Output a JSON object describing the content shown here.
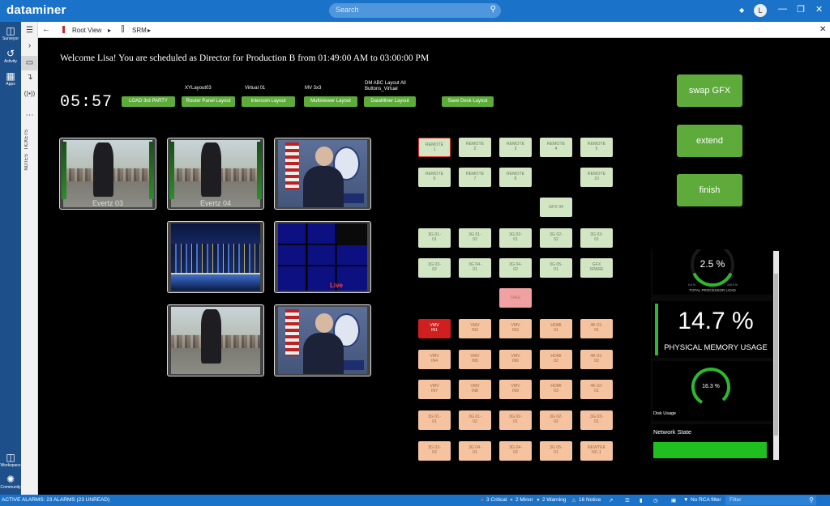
{
  "titlebar": {
    "brand": "dataminer",
    "search_placeholder": "Search",
    "avatar_initial": "L"
  },
  "rail": {
    "items": [
      {
        "label": "Surveyor",
        "icon": "surveyor-icon"
      },
      {
        "label": "Activity",
        "icon": "activity-icon"
      },
      {
        "label": "Apps",
        "icon": "apps-icon"
      }
    ],
    "bottom": [
      {
        "label": "Workspace",
        "icon": "workspace-icon"
      },
      {
        "label": "Community",
        "icon": "community-icon"
      }
    ]
  },
  "rail2": {
    "tickets": "TICKETS",
    "notes": "NOTES"
  },
  "breadcrumb": {
    "root": "Root View",
    "view": "SRM"
  },
  "main": {
    "welcome": "Welcome Lisa! You are scheduled as Director for Production B from 01:49:00 AM to 03:00:00 PM",
    "clock": "05:57",
    "layouts": [
      {
        "caption": "",
        "label": "LOAD 3rd PARTY"
      },
      {
        "caption": "XYLayout03",
        "label": "Router Panel Layout"
      },
      {
        "caption": "Virtual 01",
        "label": "Intercom Layout"
      },
      {
        "caption": "MV 3x3",
        "label": "Multiviewer Layout"
      },
      {
        "caption": "DM ABC Layout All Buttons_Virtual",
        "label": "DataMiner Layout"
      },
      {
        "caption": "",
        "label": "Save Desk Layout"
      }
    ],
    "actions": [
      "swap GFX",
      "extend",
      "finish"
    ],
    "tiles": [
      {
        "caption": "Evertz 03"
      },
      {
        "caption": "Evertz 04"
      },
      {
        "caption": ""
      },
      {
        "caption": ""
      },
      {
        "caption": "Live"
      },
      {
        "caption": ""
      },
      {
        "caption": ""
      }
    ]
  },
  "panel": {
    "remote": [
      [
        "REMOTE",
        "1"
      ],
      [
        "REMOTE",
        "2"
      ],
      [
        "REMOTE",
        "3"
      ],
      [
        "REMOTE",
        "4"
      ],
      [
        "REMOTE",
        "5"
      ],
      [
        "REMOTE",
        "6"
      ],
      [
        "REMOTE",
        "7"
      ],
      [
        "REMOTE",
        "8"
      ],
      [
        "REMOTE",
        "10"
      ]
    ],
    "gfx": [
      "GFX 04"
    ],
    "sources": [
      [
        "3G 01-",
        "01"
      ],
      [
        "3G 01-",
        "02"
      ],
      [
        "3G 02-",
        "01"
      ],
      [
        "3G 02-",
        "02"
      ],
      [
        "3G 03-",
        "01"
      ],
      [
        "3G 03-",
        "02"
      ],
      [
        "3G 04-",
        "01"
      ],
      [
        "3G 04-",
        "02"
      ],
      [
        "3G 05-",
        "01"
      ],
      [
        "GFX",
        "SPARE"
      ]
    ],
    "take": "TAKE",
    "destinations": [
      [
        "VMV",
        "IN1"
      ],
      [
        "VMV",
        "IN2"
      ],
      [
        "VMV",
        "IN3"
      ],
      [
        "HDMI",
        "01"
      ],
      [
        "4K 01-",
        "01"
      ],
      [
        "VMV",
        "IN4"
      ],
      [
        "VMV",
        "IN5"
      ],
      [
        "VMV",
        "IN6"
      ],
      [
        "HDMI",
        "02"
      ],
      [
        "4K 01-",
        "02"
      ],
      [
        "VMV",
        "IN7"
      ],
      [
        "VMV",
        "IN8"
      ],
      [
        "VMV",
        "IN9"
      ],
      [
        "HDMI",
        "03"
      ],
      [
        "4K 02-",
        "01"
      ],
      [
        "3G 01-",
        "01"
      ],
      [
        "3G 01-",
        "02"
      ],
      [
        "3G 02-",
        "01"
      ],
      [
        "3G 02-",
        "02"
      ],
      [
        "3G 03-",
        "01"
      ],
      [
        "3G 03-",
        "02"
      ],
      [
        "3G 04-",
        "01"
      ],
      [
        "3G 04-",
        "02"
      ],
      [
        "3G 05-",
        "01"
      ],
      [
        "NEWTEK",
        "NC-1"
      ]
    ],
    "selected_note": "REMOTE 1"
  },
  "stats": {
    "cpu": {
      "value": "2.5 %",
      "label": "TOTAL PROCESSOR LOAD",
      "min": "0.0 %",
      "max": "100.0 %",
      "fraction": 0.025
    },
    "memory": {
      "value": "14.7 %",
      "label": "PHYSICAL MEMORY USAGE",
      "fraction": 0.147
    },
    "disk": {
      "value": "16.3 %",
      "label": "Disk Usage",
      "fraction": 0.163
    },
    "network": {
      "label": "Network State",
      "state_color": "#1fbf1f"
    }
  },
  "statusbar": {
    "alarms": "ACTIVE ALARMS: 23 ALARMS (23 UNREAD)",
    "critical": "3 Critical",
    "minor": "2 Minor",
    "warning": "2 Warning",
    "notice": "16 Notice",
    "rca": "No RCA filter",
    "filter_placeholder": "Filter"
  },
  "colors": {
    "accent": "#1a72c9",
    "layout_green": "#5eab3b",
    "gauge_green": "#1fbf1f",
    "critical": "#e53935",
    "minor": "#ff9800",
    "warning": "#fdd835",
    "notice": "#f5b400"
  }
}
